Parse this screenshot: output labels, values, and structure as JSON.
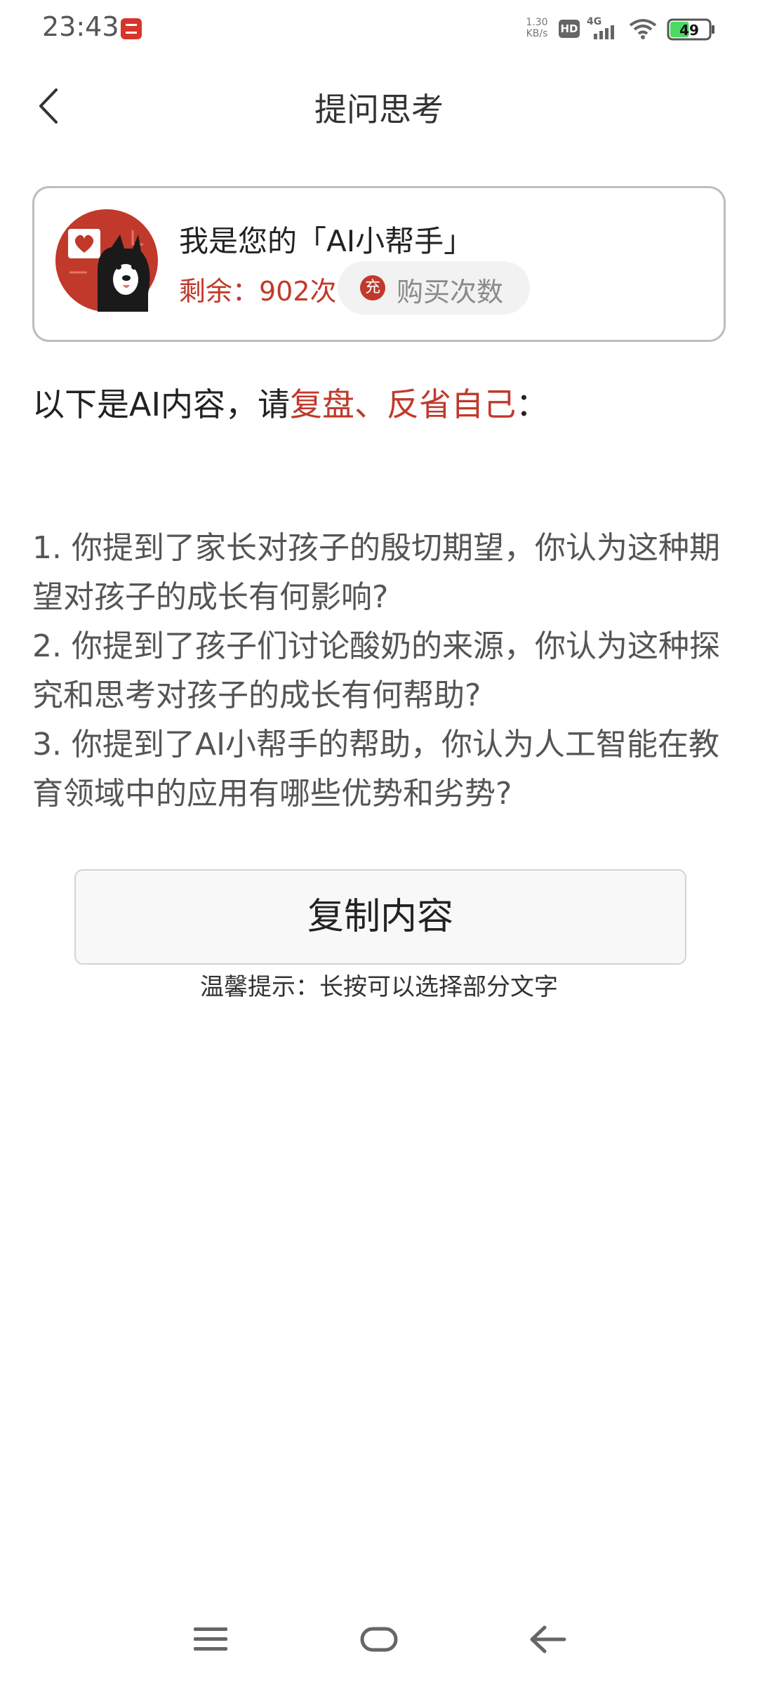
{
  "status_bar": {
    "time": "23:43",
    "net_speed_value": "1.30",
    "net_speed_unit": "KB/s",
    "hd_label": "HD",
    "network_type": "4G",
    "battery_level": "49",
    "battery_fraction": 0.49,
    "battery_color": "#4cd964"
  },
  "header": {
    "title": "提问思考"
  },
  "helper_card": {
    "title": "我是您的「AI小帮手」",
    "remaining": "剩余：902次",
    "buy_icon_text": "充",
    "buy_label": "购买次数"
  },
  "intro": {
    "prefix": "以下是AI内容，请",
    "highlight": "复盘、反省自己",
    "suffix": "："
  },
  "questions": [
    "1. 你提到了家长对孩子的殷切期望，你认为这种期望对孩子的成长有何影响?",
    "2. 你提到了孩子们讨论酸奶的来源，你认为这种探究和思考对孩子的成长有何帮助?",
    "3. 你提到了AI小帮手的帮助，你认为人工智能在教育领域中的应用有哪些优势和劣势?"
  ],
  "copy_button": {
    "label": "复制内容"
  },
  "tip": "温馨提示：长按可以选择部分文字",
  "colors": {
    "accent": "#c0392b",
    "text": "#333333",
    "border": "#bdbdbd"
  },
  "icons": {
    "back": "chevron-left-icon",
    "menu": "menu-icon",
    "home": "home-icon",
    "nav_back": "arrow-left-icon"
  }
}
